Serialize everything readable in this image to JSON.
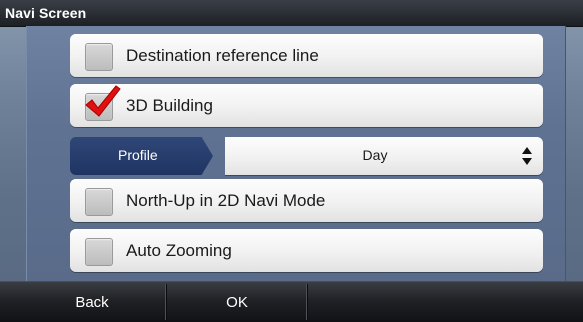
{
  "title": "Navi Screen",
  "options": [
    {
      "label": "Destination reference line",
      "checked": false
    },
    {
      "label": "3D Building",
      "checked": true
    },
    {
      "label": "North-Up in 2D Navi Mode",
      "checked": false
    },
    {
      "label": "Auto Zooming",
      "checked": false
    }
  ],
  "profile": {
    "label": "Profile",
    "value": "Day"
  },
  "bottombar": {
    "back_label": "Back",
    "ok_label": "OK"
  },
  "colors": {
    "check_red": "#e01010",
    "profile_tab": "#243b6a"
  }
}
